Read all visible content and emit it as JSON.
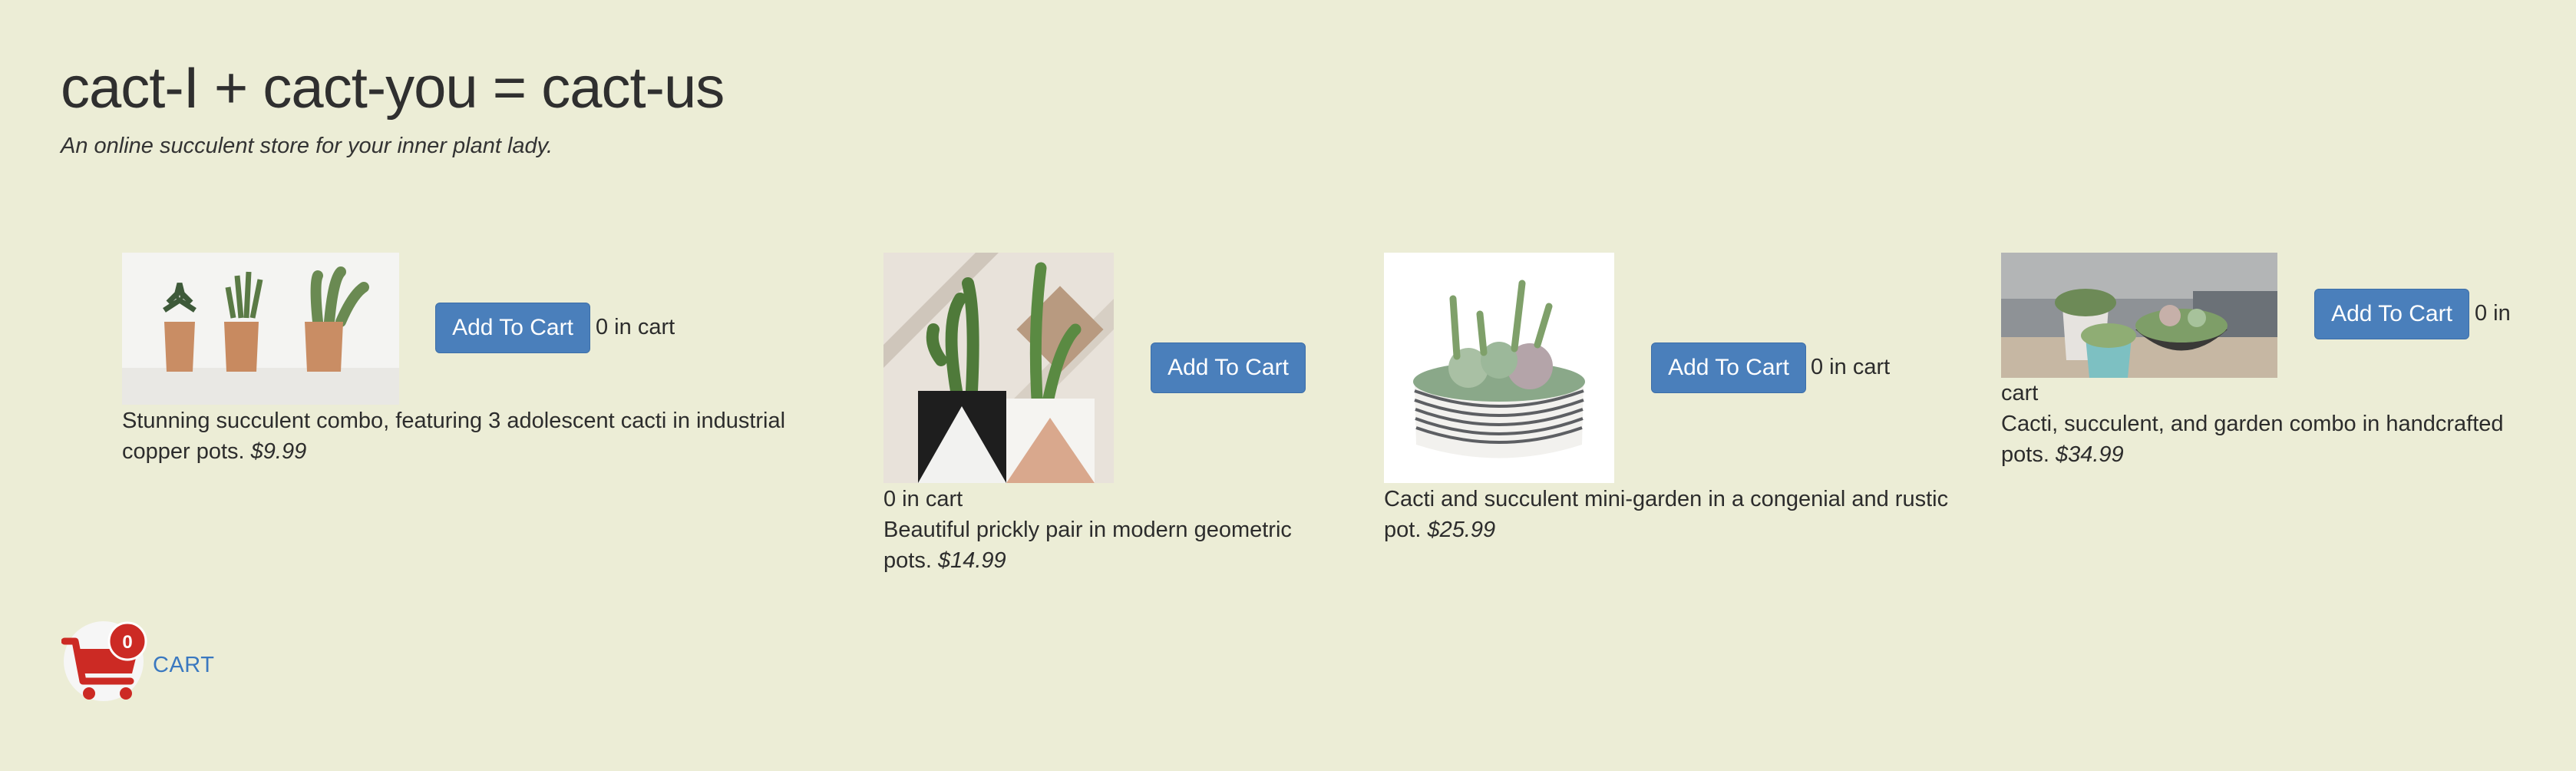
{
  "header": {
    "title": "cact-I + cact-you = cact-us",
    "subtitle": "An online succulent store for your inner plant lady."
  },
  "products": [
    {
      "button_label": "Add To Cart",
      "count_text": "0 in cart",
      "description": "Stunning succulent combo, featuring 3 adolescent cacti in industrial copper pots.",
      "price": "$9.99",
      "image_alt": "three cacti in copper pots"
    },
    {
      "button_label": "Add To Cart",
      "count_text": "0 in cart",
      "description": "Beautiful prickly pair in modern geometric pots.",
      "price": "$14.99",
      "image_alt": "two tall cacti in geometric pots"
    },
    {
      "button_label": "Add To Cart",
      "count_text": "0 in cart",
      "description": "Cacti and succulent mini-garden in a congenial and rustic pot.",
      "price": "$25.99",
      "image_alt": "succulent mini-garden in striped bowl"
    },
    {
      "button_label": "Add To Cart",
      "count_text_1": "0 in",
      "count_text_2": "cart",
      "description": "Cacti, succulent, and garden combo in handcrafted pots.",
      "price": "$34.99",
      "image_alt": "succulents in handcrafted pots"
    }
  ],
  "cart": {
    "label": "CART",
    "count": "0"
  },
  "colors": {
    "background": "#ecedd6",
    "button": "#4a7fbb",
    "cart_icon": "#cc2a24",
    "cart_label": "#3a78c0"
  },
  "icons": [
    "cart-icon"
  ]
}
